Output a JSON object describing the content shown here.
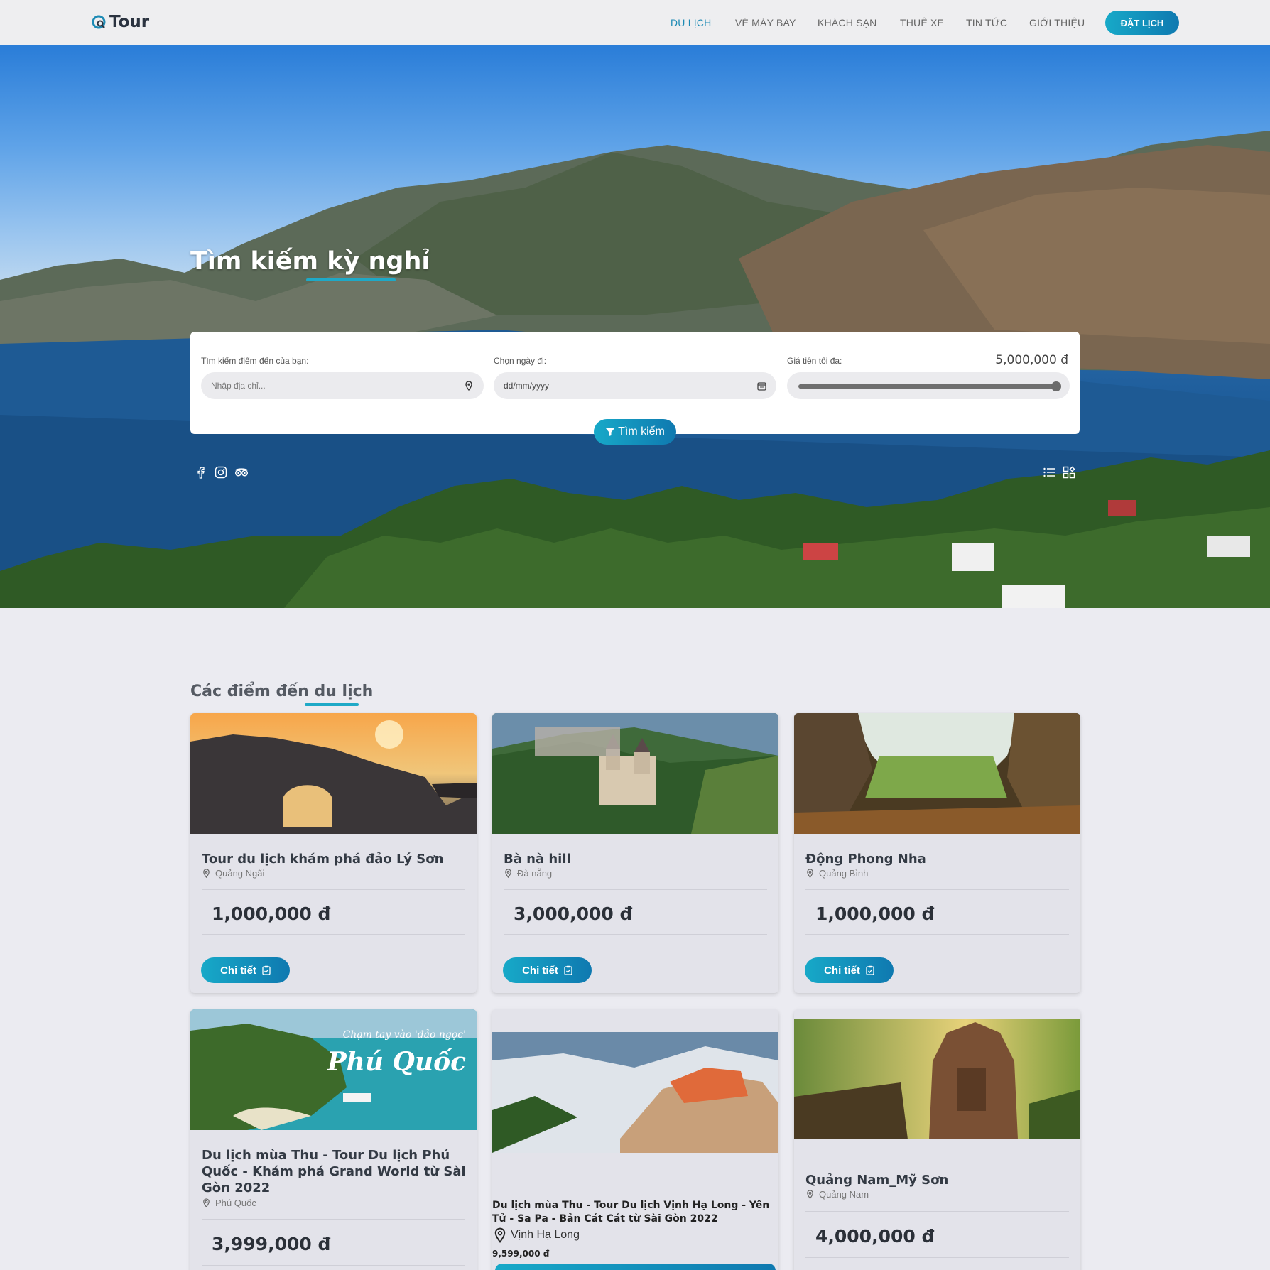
{
  "header": {
    "brand": "Tour",
    "nav": [
      {
        "label": "DU LỊCH",
        "active": true
      },
      {
        "label": "VÉ MÁY BAY",
        "active": false
      },
      {
        "label": "KHÁCH SẠN",
        "active": false
      },
      {
        "label": "THUÊ XE",
        "active": false
      },
      {
        "label": "TIN TỨC",
        "active": false
      },
      {
        "label": "GIỚI THIỆU",
        "active": false
      }
    ],
    "book_label": "ĐẶT LỊCH"
  },
  "hero": {
    "title": "Tìm kiếm kỳ nghỉ"
  },
  "search": {
    "destination_label": "Tìm kiếm điểm đến của bạn:",
    "destination_placeholder": "Nhập địa chỉ...",
    "date_label": "Chọn ngày đi:",
    "date_placeholder": "dd/mm/yyyy",
    "price_label": "Giá tiền tối đa:",
    "price_value": "5,000,000 đ",
    "price_slider_level": 1.0,
    "button_label": "Tìm kiếm"
  },
  "icons": {
    "social": [
      "facebook-icon",
      "instagram-icon",
      "tripadvisor-icon"
    ],
    "view": [
      "list-view-icon",
      "grid-view-icon"
    ]
  },
  "section": {
    "title": "Các điểm đến du lịch"
  },
  "cards": [
    {
      "title": "Tour du lịch khám phá đảo Lý Sơn",
      "location": "Quảng Ngãi",
      "price": "1,000,000 đ",
      "button": "Chi tiết"
    },
    {
      "title": "Bà nà hill",
      "location": "Đà nẵng",
      "price": "3,000,000 đ",
      "button": "Chi tiết"
    },
    {
      "title": "Động Phong Nha",
      "location": "Quảng Bình",
      "price": "1,000,000 đ",
      "button": "Chi tiết"
    },
    {
      "title": "Du lịch mùa Thu - Tour Du lịch Phú Quốc - Khám phá Grand World từ Sài Gòn 2022",
      "location": "Phú Quốc",
      "price": "3,999,000 đ",
      "image_text_line1": "Chạm tay vào 'đảo ngọc'",
      "image_text_line2": "Phú Quốc"
    },
    {
      "title": "Du lịch mùa Thu - Tour Du lịch Vịnh Hạ Long - Yên Tử - Sa Pa - Bản Cát Cát từ Sài Gòn 2022",
      "location": "Vịnh Hạ Long",
      "price": "9,599,000 đ"
    },
    {
      "title": "Quảng Nam_Mỹ Sơn",
      "location": "Quảng Nam",
      "price": "4,000,000 đ"
    }
  ],
  "colors": {
    "accent": "#1fa9c7",
    "accent_dark": "#0f79b0",
    "nav_active": "#1d8bb5"
  }
}
